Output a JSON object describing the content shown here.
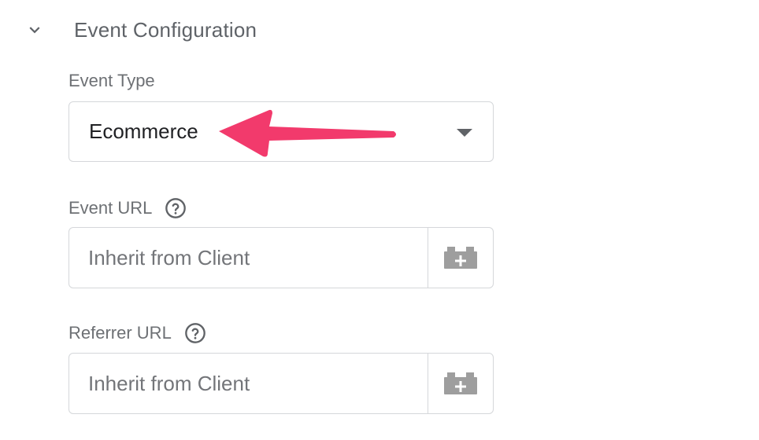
{
  "section": {
    "title": "Event Configuration",
    "chevron_icon": "chevron-down-icon"
  },
  "event_type": {
    "label": "Event Type",
    "selected_value": "Ecommerce"
  },
  "event_url": {
    "label": "Event URL",
    "placeholder": "Inherit from Client",
    "value": "",
    "help_icon": "help-circle-icon",
    "variable_icon": "variable-block-add-icon"
  },
  "referrer_url": {
    "label": "Referrer URL",
    "placeholder": "Inherit from Client",
    "value": "",
    "help_icon": "help-circle-icon",
    "variable_icon": "variable-block-add-icon"
  },
  "annotation": {
    "arrow_color": "#f23a6c"
  },
  "colors": {
    "border": "#d5d7da",
    "label_text": "#6d7074",
    "icon_gray": "#9e9e9e"
  }
}
